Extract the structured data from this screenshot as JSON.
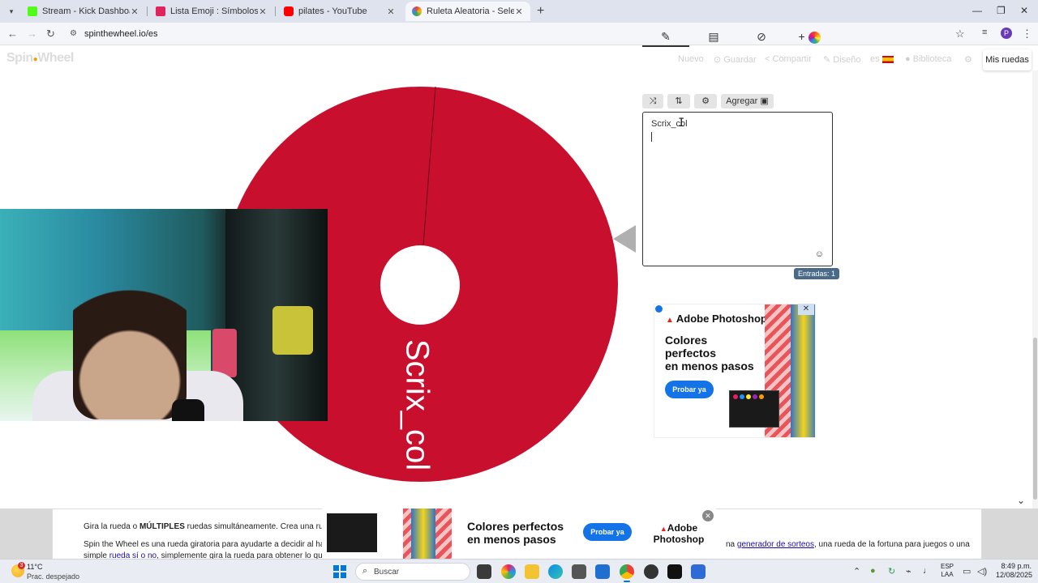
{
  "browser": {
    "tabs": [
      {
        "title": "Stream - Kick Dashboard",
        "favicon_color": "#53fc18"
      },
      {
        "title": "Lista Emoji : Símbolos emoji na",
        "favicon_color": "#e0245e"
      },
      {
        "title": "pilates - YouTube",
        "favicon_color": "#ff0000"
      },
      {
        "title": "Ruleta Aleatoria - Selector Pers",
        "favicon_color": "#4285f4"
      }
    ],
    "active_tab_index": 3,
    "url": "spinthewheel.io/es",
    "profile_initial": "P"
  },
  "site": {
    "logo_part1": "Spin",
    "logo_part2": "Wheel",
    "nav": {
      "nuevo": "Nuevo",
      "guardar": "Guardar",
      "compartir": "Compartir",
      "diseno": "Diseño",
      "lang": "es",
      "biblioteca": "Biblioteca"
    },
    "mis_ruedas": "Mis ruedas"
  },
  "wheel": {
    "segment_label": "Scrix_col",
    "segment_color": "#c8102e"
  },
  "editor": {
    "agregar_label": "Agregar",
    "entry_text": "Scrix_col",
    "entradas_label": "Entradas: 1"
  },
  "ad_side": {
    "brand": "Adobe Photoshop",
    "headline_line1": "Colores",
    "headline_line2": "perfectos",
    "headline_line3": "en menos pasos",
    "cta": "Probar ya"
  },
  "ad_bottom": {
    "headline_line1": "Colores perfectos",
    "headline_line2": "en menos pasos",
    "cta": "Probar ya",
    "brand_line1": "Adobe",
    "brand_line2": "Photoshop"
  },
  "bottom_text": {
    "line1_prefix": "Gira la rueda o ",
    "line1_bold": "MÚLTIPLES",
    "line1_suffix": " ruedas simultáneamente. Crea una rueda pe",
    "line2": "Spin the Wheel es una rueda giratoria para ayudarte a decidir al hacer u",
    "line3_prefix": "simple ",
    "line3_link": "rueda sí o no",
    "line3_suffix": ", simplemente gira la rueda para obtener lo que nec",
    "right2_prefix": "na ",
    "right2_link": "generador de sorteos",
    "right2_suffix": ", una rueda de la fortuna para juegos o una"
  },
  "taskbar": {
    "weather_temp": "11°C",
    "weather_desc": "Prac. despejado",
    "weather_badge": "3",
    "search_placeholder": "Buscar",
    "lang_line1": "ESP",
    "lang_line2": "LAA",
    "time": "8:49 p.m.",
    "date": "12/08/2025"
  }
}
